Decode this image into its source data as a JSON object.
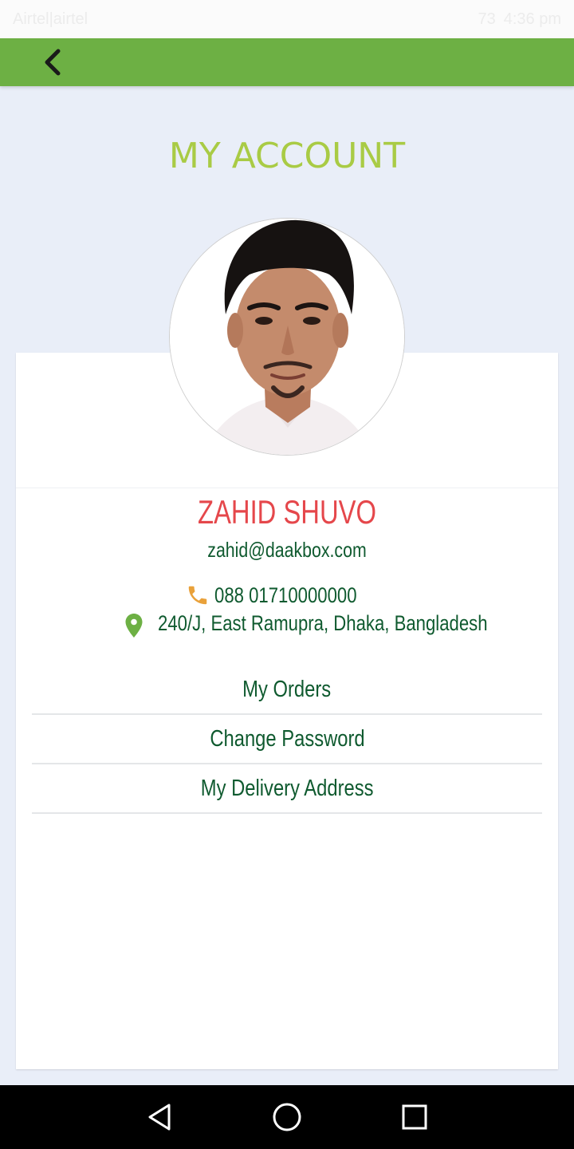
{
  "status_bar": {
    "carrier": "Airtel|airtel",
    "time": "4:36 pm",
    "battery": "73"
  },
  "toolbar": {
    "back_icon": "chevron-left-icon"
  },
  "page": {
    "title": "MY ACCOUNT"
  },
  "profile": {
    "name": "ZAHID SHUVO",
    "email": "zahid@daakbox.com",
    "phone": "088 01710000000",
    "address": "240/J, East Ramupra, Dhaka, Bangladesh",
    "phone_icon": "phone-icon",
    "location_icon": "location-pin-icon"
  },
  "menu": {
    "items": [
      {
        "label": "My Orders"
      },
      {
        "label": "Change Password"
      },
      {
        "label": "My Delivery Address"
      }
    ]
  },
  "colors": {
    "toolbar": "#6db044",
    "title": "#a9cb45",
    "name": "#e5474b",
    "text": "#0f5a2f",
    "phone_icon": "#e9a13a",
    "location_icon": "#6db044"
  }
}
